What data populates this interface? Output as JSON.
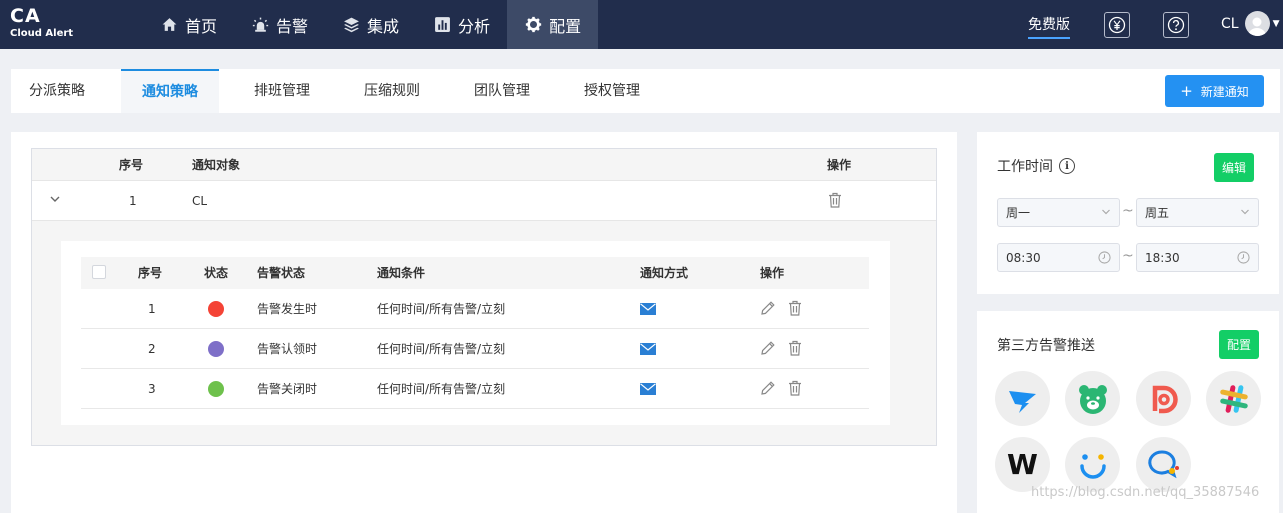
{
  "app": {
    "logo": "CA",
    "logo_sub": "Cloud Alert"
  },
  "nav": [
    {
      "label": "首页",
      "icon": "home-icon"
    },
    {
      "label": "告警",
      "icon": "alarm-icon"
    },
    {
      "label": "集成",
      "icon": "layers-icon"
    },
    {
      "label": "分析",
      "icon": "chart-icon"
    },
    {
      "label": "配置",
      "icon": "gear-icon",
      "active": true
    }
  ],
  "header": {
    "plan": "免费版",
    "yen_icon": "yen-icon",
    "help_icon": "help-icon",
    "user": "CL"
  },
  "tabs": [
    {
      "label": "分派策略"
    },
    {
      "label": "通知策略",
      "active": true
    },
    {
      "label": "排班管理"
    },
    {
      "label": "压缩规则"
    },
    {
      "label": "团队管理"
    },
    {
      "label": "授权管理"
    }
  ],
  "new_button": {
    "plus": "+",
    "label": "新建通知"
  },
  "policy_table": {
    "headers": {
      "index": "序号",
      "target": "通知对象",
      "action": "操作"
    },
    "rows": [
      {
        "index": "1",
        "target": "CL"
      }
    ]
  },
  "rules_table": {
    "headers": {
      "index": "序号",
      "status": "状态",
      "alert_state": "告警状态",
      "condition": "通知条件",
      "method": "通知方式",
      "action": "操作"
    },
    "rows": [
      {
        "index": "1",
        "color": "#f44336",
        "alert_state": "告警发生时",
        "condition": "任何时间/所有告警/立刻",
        "method": "email-icon"
      },
      {
        "index": "2",
        "color": "#7e6fc8",
        "alert_state": "告警认领时",
        "condition": "任何时间/所有告警/立刻",
        "method": "email-icon"
      },
      {
        "index": "3",
        "color": "#6ec14c",
        "alert_state": "告警关闭时",
        "condition": "任何时间/所有告警/立刻",
        "method": "email-icon"
      }
    ]
  },
  "work_time": {
    "title": "工作时间",
    "edit_label": "编辑",
    "day_from": "周一",
    "day_to": "周五",
    "time_from": "08:30",
    "time_to": "18:30",
    "tilde": "~"
  },
  "third_party": {
    "title": "第三方告警推送",
    "config_label": "配置",
    "apps": [
      {
        "icon": "dingtalk-icon"
      },
      {
        "icon": "bear-icon"
      },
      {
        "icon": "red-d-icon"
      },
      {
        "icon": "slack-icon"
      },
      {
        "icon": "w-logo-icon",
        "text": "W"
      },
      {
        "icon": "smile-icon"
      },
      {
        "icon": "chat-bubble-icon"
      }
    ]
  },
  "colors": {
    "topbar": "#212d4c",
    "accent": "#1d8ce0",
    "primary_button": "#2491f2",
    "success_button": "#13ce66"
  },
  "watermark": "https://blog.csdn.net/qq_35887546"
}
